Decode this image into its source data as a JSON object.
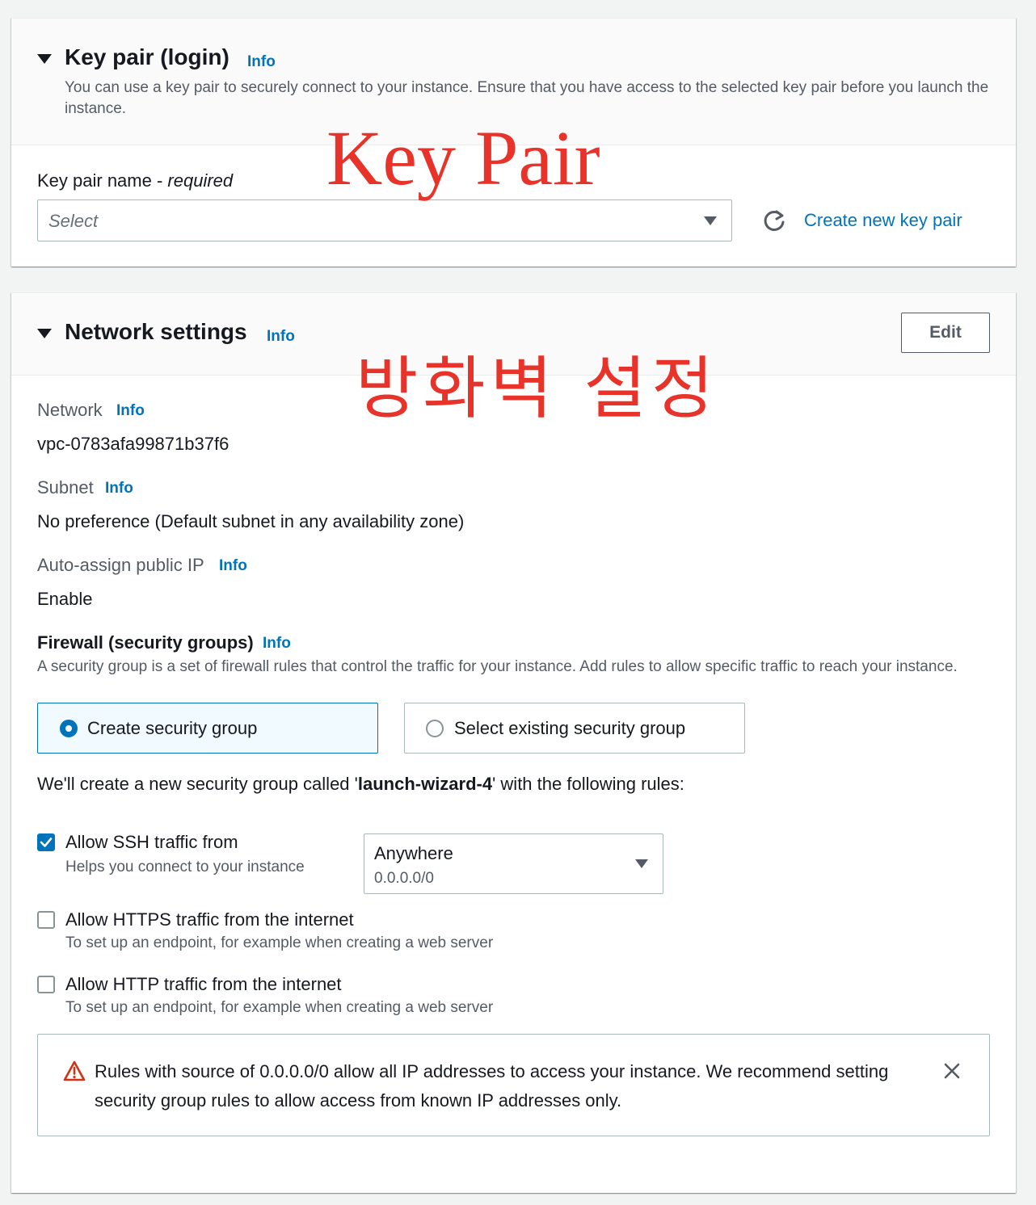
{
  "key_pair": {
    "title": "Key pair (login)",
    "info": "Info",
    "description": "You can use a key pair to securely connect to your instance. Ensure that you have access to the selected key pair before you launch the instance.",
    "field_label": "Key pair name - ",
    "field_required": "required",
    "select_placeholder": "Select",
    "create_link": "Create new key pair"
  },
  "network": {
    "title": "Network settings",
    "info": "Info",
    "edit_label": "Edit",
    "network_label": "Network",
    "network_value": "vpc-0783afa99871b37f6",
    "subnet_label": "Subnet",
    "subnet_value": "No preference (Default subnet in any availability zone)",
    "public_ip_label": "Auto-assign public IP",
    "public_ip_value": "Enable",
    "firewall_label": "Firewall (security groups)",
    "firewall_desc": "A security group is a set of firewall rules that control the traffic for your instance. Add rules to allow specific traffic to reach your instance.",
    "radio_create": "Create security group",
    "radio_existing": "Select existing security group",
    "new_sg_prefix": "We'll create a new security group called '",
    "new_sg_name": "launch-wizard-4",
    "new_sg_suffix": "' with the following rules:",
    "ssh_label": "Allow SSH traffic from",
    "ssh_desc": "Helps you connect to your instance",
    "ssh_source_label": "Anywhere",
    "ssh_source_cidr": "0.0.0.0/0",
    "https_label": "Allow HTTPS traffic from the internet",
    "https_desc": "To set up an endpoint, for example when creating a web server",
    "http_label": "Allow HTTP traffic from the internet",
    "http_desc": "To set up an endpoint, for example when creating a web server",
    "warning_line1": "Rules with source of 0.0.0.0/0 allow all IP addresses to access your instance. We recommend setting",
    "warning_line2": "security group rules to allow access from known IP addresses only."
  },
  "overlay": {
    "key_pair_annotation": "Key Pair",
    "firewall_annotation": "방화벽 설정"
  },
  "colors": {
    "accent": "#0073bb",
    "annotation": "#e8332a",
    "warning": "#d13212"
  }
}
